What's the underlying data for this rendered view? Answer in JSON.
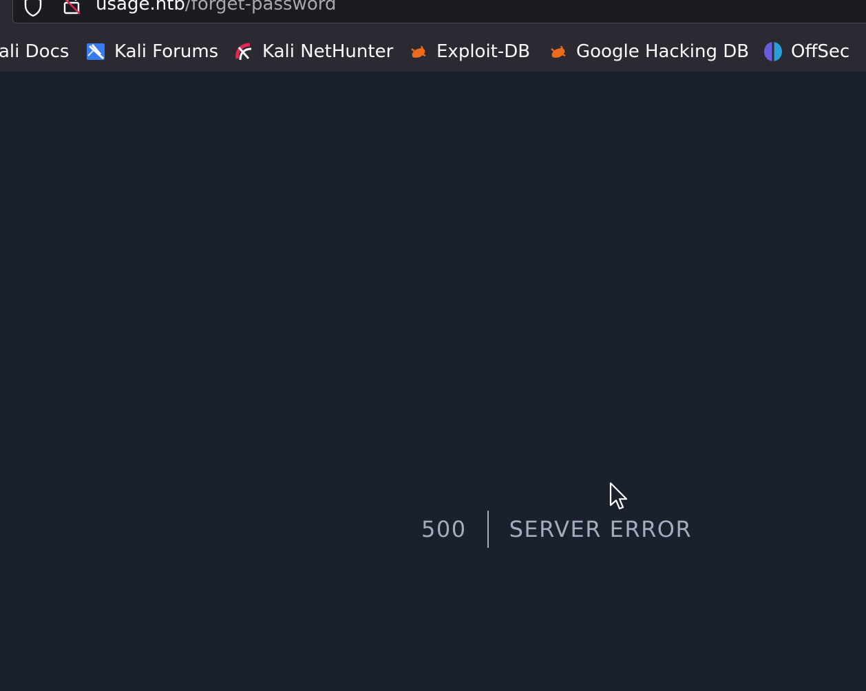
{
  "browser": {
    "url_domain": "usage.htb",
    "url_path": "/forget-password",
    "bookmarks": [
      {
        "label": "ali Docs",
        "icon": "kali-docs-icon"
      },
      {
        "label": "Kali Forums",
        "icon": "kali-forums-icon"
      },
      {
        "label": "Kali NetHunter",
        "icon": "kali-nethunter-icon"
      },
      {
        "label": "Exploit-DB",
        "icon": "exploit-db-icon"
      },
      {
        "label": "Google Hacking DB",
        "icon": "google-hacking-db-icon"
      },
      {
        "label": "OffSec",
        "icon": "offsec-icon"
      }
    ]
  },
  "error": {
    "code": "500",
    "message": "SERVER ERROR"
  },
  "colors": {
    "page_background": "#1a202c",
    "error_text": "#a0aec0",
    "toolbar_background": "#2b2a33",
    "url_domain": "#fbfbfe",
    "url_path": "#a8a8b0"
  }
}
